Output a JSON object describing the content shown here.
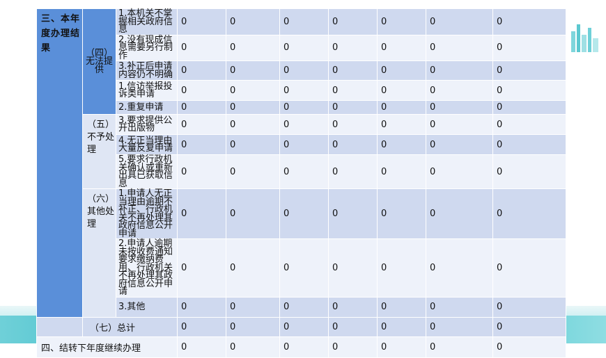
{
  "section3_title": "三、本年度办理结果",
  "group4_label": "（四）无法提供",
  "group5_label": "（五）不予处理",
  "group6_label": "（六）其他处理",
  "total_label": "（七）总计",
  "section4_label": "四、结转下年度继续办理",
  "items": [
    "1.本机关不掌握相关政府信息",
    "2.没有现成信息需要另行制作",
    "3.补正后申请内容仍不明确",
    "1.信访举报投诉类申请",
    "2.重复申请",
    "3.要求提供公开出版物",
    "4.无正当理由大量反复申请",
    "5.要求行政机关确认或重新出具已获取信息",
    "1.申请人无正当理由逾期不补正、行政机关不再处理其政府信息公开申请",
    "2.申请人逾期未按收费通知要求缴纳费用、行政机关不再处理其政府信息公开申请",
    "3.其他"
  ],
  "rows": [
    [
      "0",
      "0",
      "0",
      "0",
      "0",
      "0",
      "0"
    ],
    [
      "0",
      "0",
      "0",
      "0",
      "0",
      "0",
      "0"
    ],
    [
      "0",
      "0",
      "0",
      "0",
      "0",
      "0",
      "0"
    ],
    [
      "0",
      "0",
      "0",
      "0",
      "0",
      "0",
      "0"
    ],
    [
      "0",
      "0",
      "0",
      "0",
      "0",
      "0",
      "0"
    ],
    [
      "0",
      "0",
      "0",
      "0",
      "0",
      "0",
      "0"
    ],
    [
      "0",
      "0",
      "0",
      "0",
      "0",
      "0",
      "0"
    ],
    [
      "0",
      "0",
      "0",
      "0",
      "0",
      "0",
      "0"
    ],
    [
      "0",
      "0",
      "0",
      "0",
      "0",
      "0",
      "0"
    ],
    [
      "0",
      "0",
      "0",
      "0",
      "0",
      "0",
      "0"
    ],
    [
      "0",
      "0",
      "0",
      "0",
      "0",
      "0",
      "0"
    ]
  ],
  "total_row": [
    "0",
    "0",
    "0",
    "0",
    "0",
    "0",
    "0"
  ],
  "section4_row": [
    "0",
    "0",
    "0",
    "0",
    "0",
    "0",
    "0"
  ]
}
